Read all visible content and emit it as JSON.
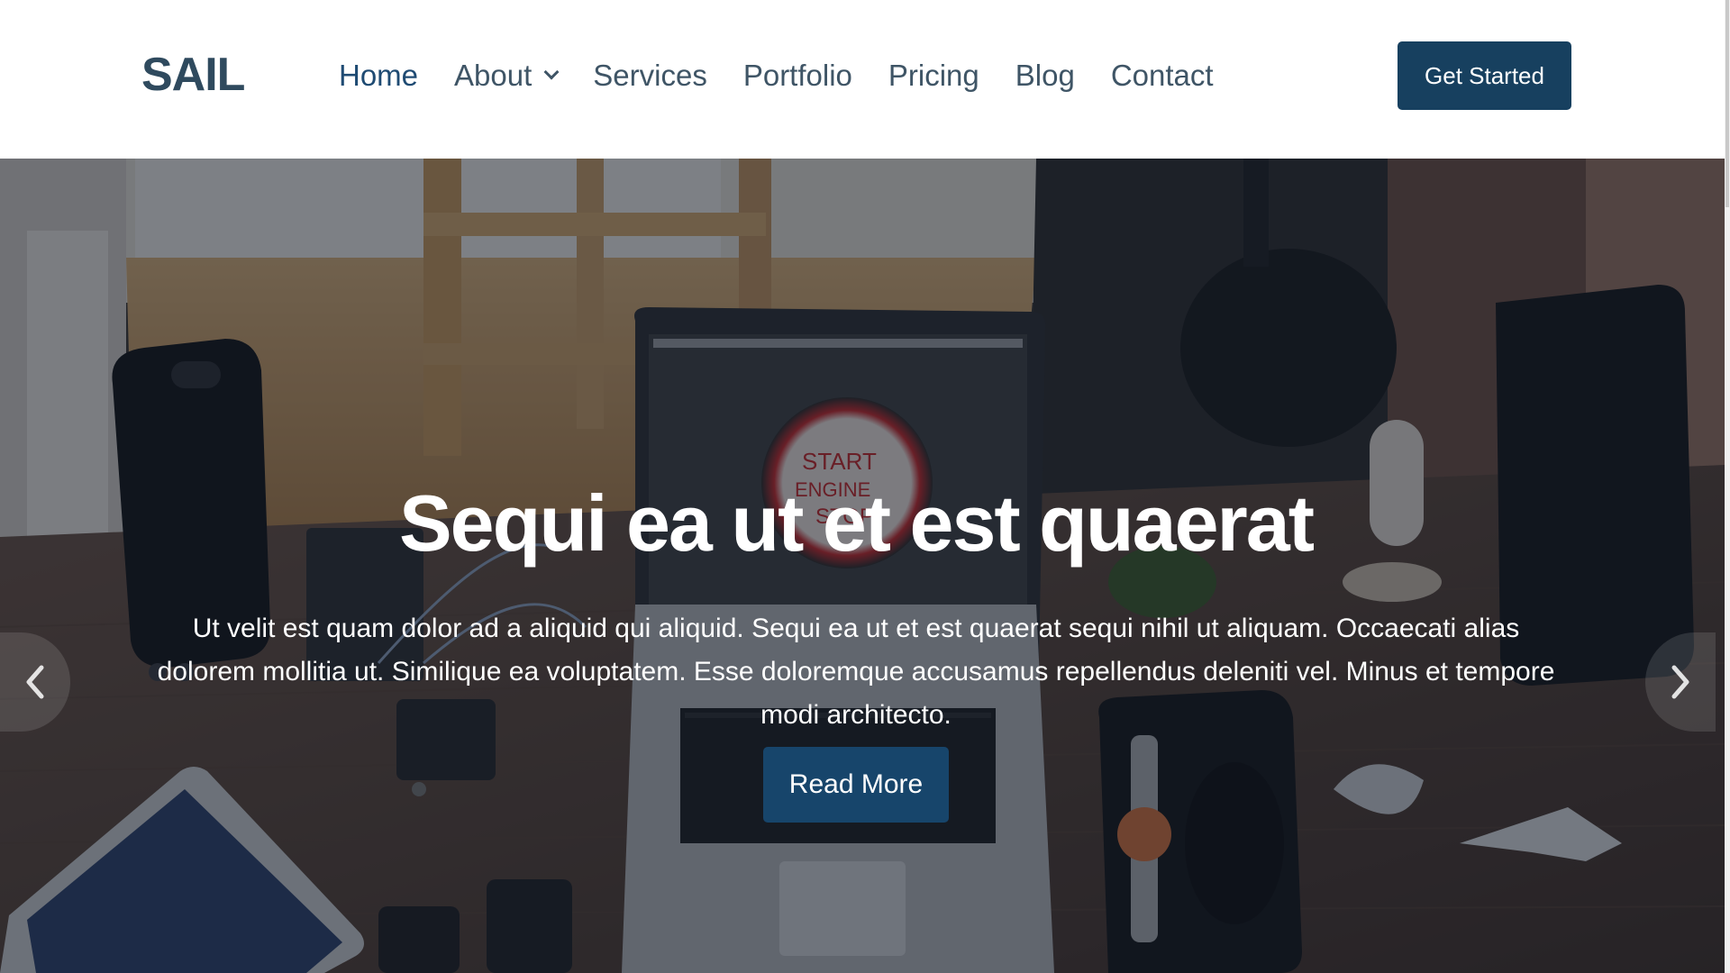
{
  "header": {
    "logo": "SAIL",
    "nav": [
      {
        "label": "Home",
        "active": true
      },
      {
        "label": "About",
        "dropdown": true
      },
      {
        "label": "Services"
      },
      {
        "label": "Portfolio"
      },
      {
        "label": "Pricing"
      },
      {
        "label": "Blog"
      },
      {
        "label": "Contact"
      }
    ],
    "cta_label": "Get Started"
  },
  "hero": {
    "title": "Sequi ea ut et est quaerat",
    "text": "Ut velit est quam dolor ad a aliquid qui aliquid. Sequi ea ut et est quaerat sequi nihil ut aliquam. Occaecati alias dolorem mollitia ut. Similique ea voluptatem. Esse doloremque accusamus repellendus deleniti vel. Minus et tempore modi architecto.",
    "button_label": "Read More",
    "prev_icon": "chevron-left-icon",
    "next_icon": "chevron-right-icon",
    "background_image": "desk-workspace-photo",
    "laptop_screen_text": [
      "START",
      "ENGINE",
      "STOP"
    ]
  },
  "colors": {
    "primary": "#17405f",
    "nav_text": "#3f5566",
    "nav_active": "#1f4b73",
    "overlay": "#121824"
  }
}
